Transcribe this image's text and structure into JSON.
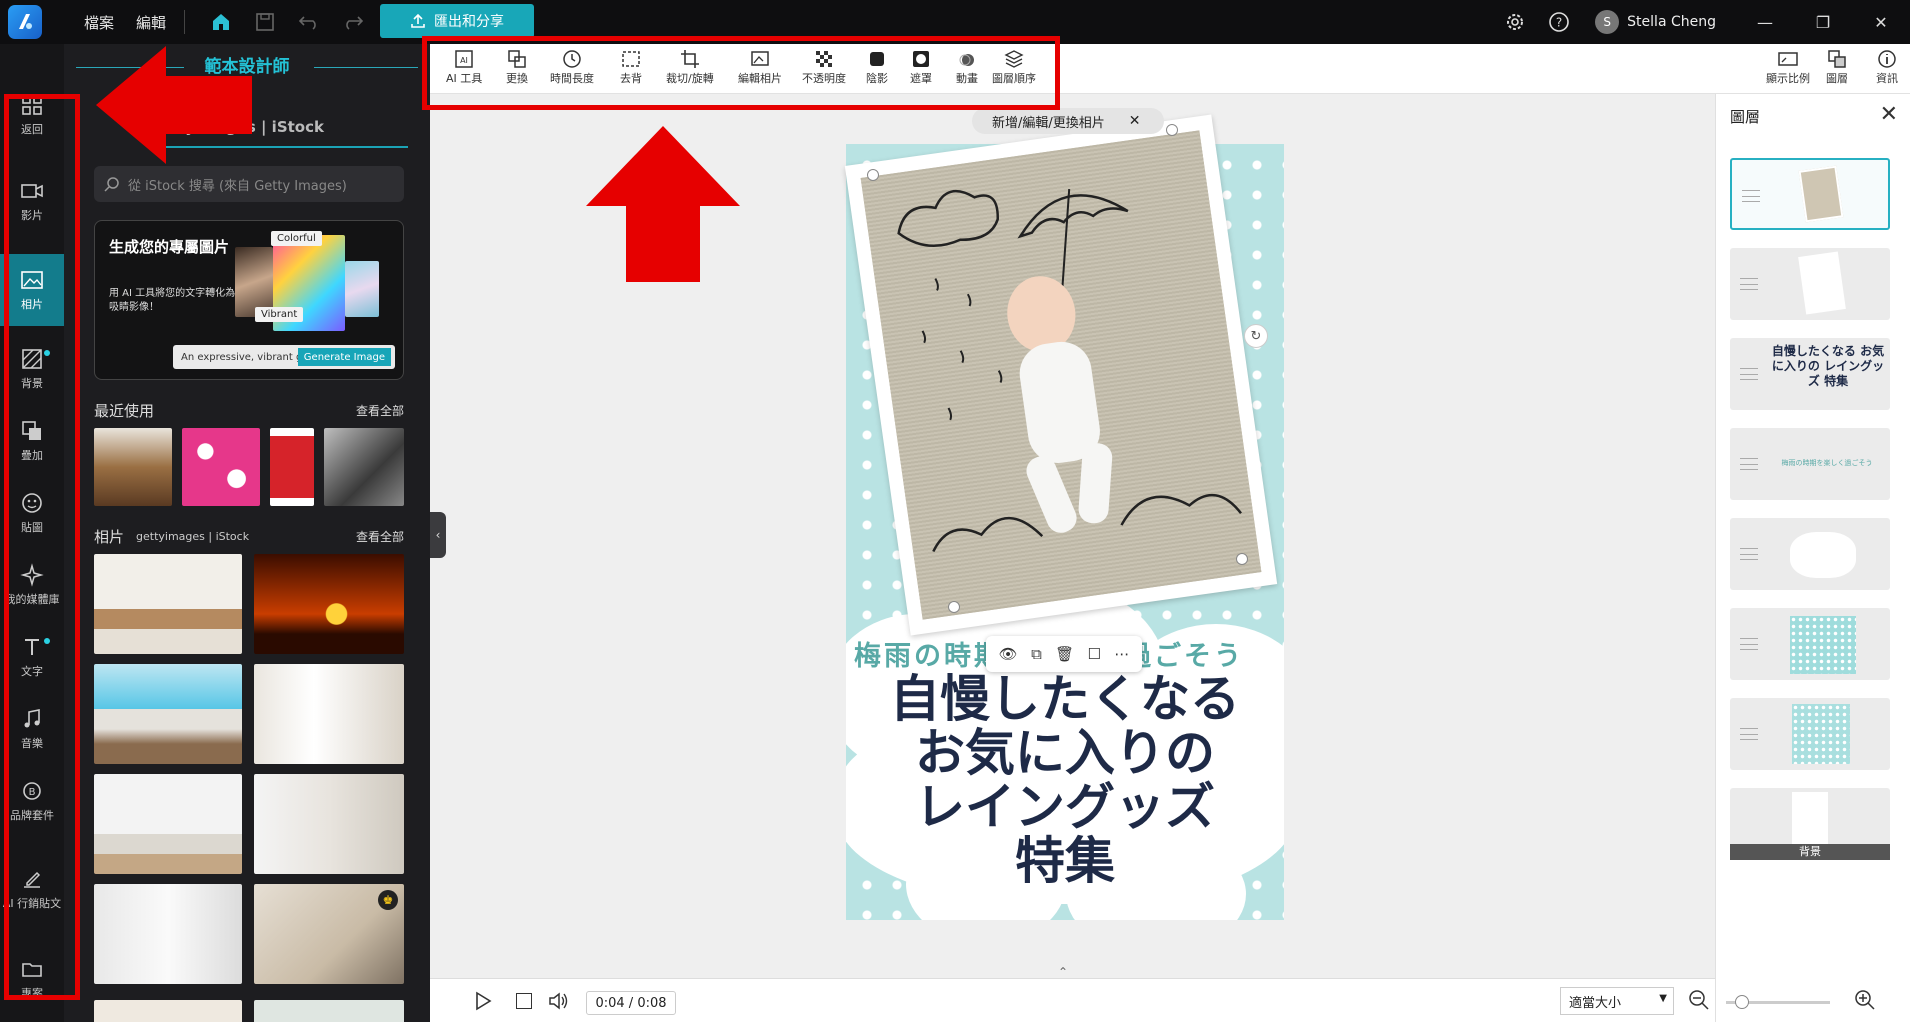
{
  "topbar": {
    "menu": [
      "檔案",
      "編輯"
    ],
    "export_label": "匯出和分享",
    "user_initial": "S",
    "user_name": "Stella Cheng"
  },
  "tools": [
    {
      "label": "AI 工具",
      "icon": "ai-tools-icon"
    },
    {
      "label": "更換",
      "icon": "replace-icon"
    },
    {
      "label": "時間長度",
      "icon": "clock-icon"
    },
    {
      "label": "去背",
      "icon": "remove-background-icon"
    },
    {
      "label": "裁切/旋轉",
      "icon": "crop-icon"
    },
    {
      "label": "編輯相片",
      "icon": "edit-photo-icon"
    },
    {
      "label": "不透明度",
      "icon": "opacity-icon"
    },
    {
      "label": "陰影",
      "icon": "shadow-icon"
    },
    {
      "label": "遮罩",
      "icon": "mask-icon"
    },
    {
      "label": "動畫",
      "icon": "animation-icon"
    },
    {
      "label": "圖層順序",
      "icon": "layer-order-icon"
    }
  ],
  "tools_right": [
    {
      "label": "顯示比例",
      "icon": "aspect-ratio-icon"
    },
    {
      "label": "圖層",
      "icon": "layers-icon"
    },
    {
      "label": "資訊",
      "icon": "info-icon"
    }
  ],
  "iconbar": [
    {
      "label": "返回",
      "icon": "grid-icon"
    },
    {
      "label": "影片",
      "icon": "video-icon"
    },
    {
      "label": "相片",
      "icon": "photo-icon",
      "active": true
    },
    {
      "label": "背景",
      "icon": "background-icon",
      "dot": true
    },
    {
      "label": "疊加",
      "icon": "overlay-icon"
    },
    {
      "label": "貼圖",
      "icon": "sticker-icon"
    },
    {
      "label": "我的媒體庫",
      "icon": "media-library-icon"
    },
    {
      "label": "文字",
      "icon": "text-icon",
      "dot": true
    },
    {
      "label": "音樂",
      "icon": "music-icon"
    },
    {
      "label": "品牌套件",
      "icon": "brand-kit-icon"
    },
    {
      "label": "AI 行銷貼文",
      "icon": "ai-post-icon"
    },
    {
      "label": "專案",
      "icon": "project-icon"
    }
  ],
  "sidepanel": {
    "title": "範本設計師",
    "tab_source": "gettyimages | iStock",
    "tab_istock": "iStock",
    "search_placeholder": "從 iStock 搜尋 (來自 Getty Images)",
    "gen_title": "生成您的專屬圖片",
    "gen_sub": "用 AI 工具將您的文字轉化為吸睛影像！",
    "gen_tag_colorful": "Colorful",
    "gen_tag_vibrant": "Vibrant",
    "gen_prompt": "An expressive, vibrant girl",
    "gen_button": "Generate Image",
    "recent_label": "最近使用",
    "recent_all": "查看全部",
    "photos_label": "相片",
    "photos_brand": "gettyimages | iStock",
    "photos_all": "查看全部"
  },
  "canvas": {
    "edit_pill": "新增/編輯/更換相片",
    "subtitle": "梅雨の時期を楽しく過ごそう",
    "title_lines": [
      "自慢したくなる",
      "お気に入りの",
      "レイングッズ",
      "特集"
    ]
  },
  "layers": {
    "title": "圖層",
    "items": [
      {
        "kind": "photo"
      },
      {
        "kind": "frame"
      },
      {
        "kind": "title-text",
        "text": "自慢したくなる お気に入りの レイングッズ 特集"
      },
      {
        "kind": "subtitle-text",
        "text": "梅雨の時期を楽しく過ごそう"
      },
      {
        "kind": "cloud"
      },
      {
        "kind": "dots"
      },
      {
        "kind": "dots2"
      },
      {
        "kind": "background",
        "label": "背景"
      }
    ]
  },
  "bottombar": {
    "time": "0:04 / 0:08",
    "zoom_option": "適當大小"
  },
  "colors": {
    "accent": "#18a7b8",
    "annotation_red": "#e60000",
    "artboard_bg": "#b9e3e3",
    "title_text": "#1e2a47",
    "subtitle_text": "#58a9a6"
  }
}
